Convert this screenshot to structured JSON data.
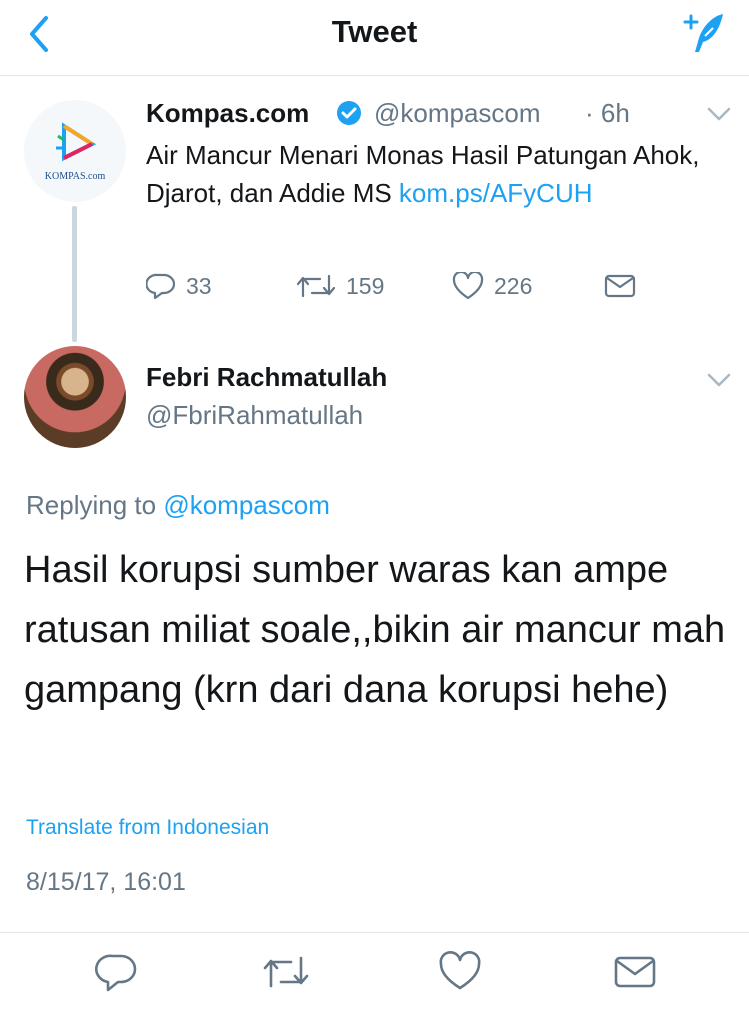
{
  "nav": {
    "title": "Tweet"
  },
  "quoted_tweet": {
    "avatar_text": "KOMPAS.com",
    "name": "Kompas.com",
    "handle": "@kompascom",
    "separator": "·",
    "time": "6h",
    "text": "Air Mancur Menari Monas Hasil Patungan Ahok, Djarot, dan Addie MS ",
    "link": "kom.ps/AFyCUH",
    "reply_count": "33",
    "retweet_count": "159",
    "like_count": "226"
  },
  "reply_tweet": {
    "name": "Febri Rachmatullah",
    "handle": "@FbriRahmatullah",
    "replying_prefix": "Replying to ",
    "replying_to": "@kompascom",
    "text": "Hasil korupsi sumber waras kan ampe ratusan miliat soale,,bikin air mancur mah gampang (krn dari dana korupsi hehe)",
    "translate": "Translate from Indonesian",
    "timestamp": "8/15/17, 16:01"
  },
  "colors": {
    "accent": "#1da1f2",
    "secondary_text": "#657786",
    "primary_text": "#14171a",
    "divider": "#e1e8ed"
  },
  "icons": [
    "back-icon",
    "compose-icon",
    "verified-icon",
    "chevron-down-icon",
    "reply-icon",
    "retweet-icon",
    "like-icon",
    "dm-icon"
  ]
}
